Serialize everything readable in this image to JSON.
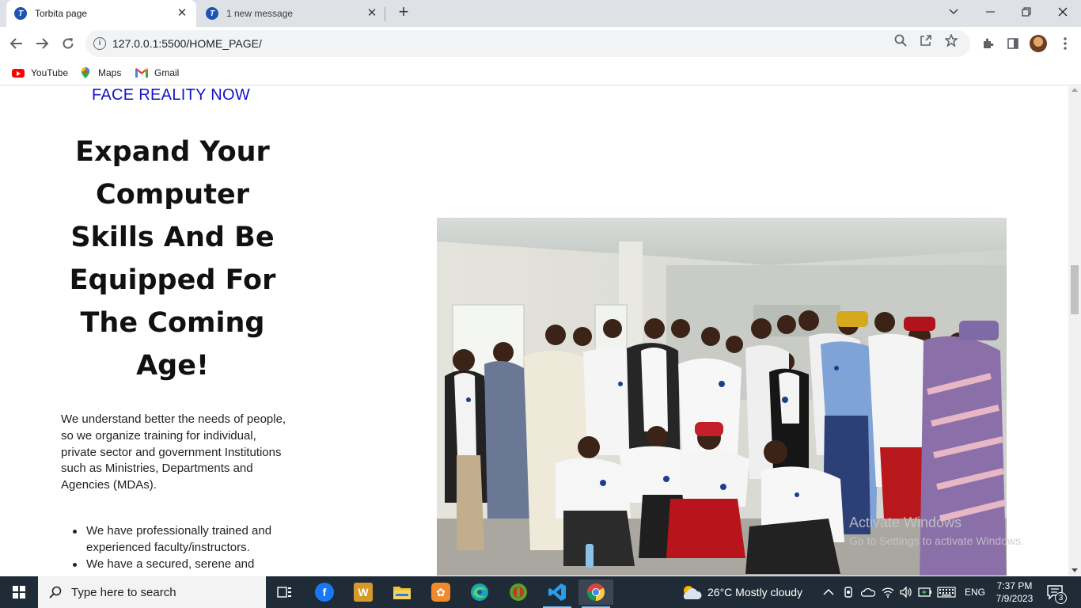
{
  "browser": {
    "tabs": [
      {
        "title": "Torbita page",
        "active": true
      },
      {
        "title": "1 new message",
        "active": false
      }
    ],
    "url": "127.0.0.1:5500/HOME_PAGE/",
    "bookmarks": [
      {
        "label": "YouTube",
        "icon": "youtube-icon"
      },
      {
        "label": "Maps",
        "icon": "maps-icon"
      },
      {
        "label": "Gmail",
        "icon": "gmail-icon"
      }
    ]
  },
  "page": {
    "tagline": "FACE REALITY NOW",
    "headline": "Expand Your Computer Skills And Be Equipped For The Coming Age!",
    "paragraph": "We understand better the needs of people, so we organize training for individual, private sector and government Institutions such as Ministries, Departments and Agencies (MDAs).",
    "bullets": [
      "We have professionally trained and experienced faculty/instructors.",
      "We have a secured, serene and"
    ],
    "photo_alt": "Group photo of training participants in white polo shirts",
    "watermark": {
      "line1": "Activate Windows",
      "line2": "Go to Settings to activate Windows."
    }
  },
  "taskbar": {
    "search_placeholder": "Type here to search",
    "weather": "26°C  Mostly cloudy",
    "language": "ENG",
    "time": "7:37 PM",
    "date": "7/9/2023",
    "notification_count": "3"
  },
  "colors": {
    "tagline": "#1414c8",
    "taskbar": "#1f2b36",
    "tabstrip": "#dee1e6"
  }
}
